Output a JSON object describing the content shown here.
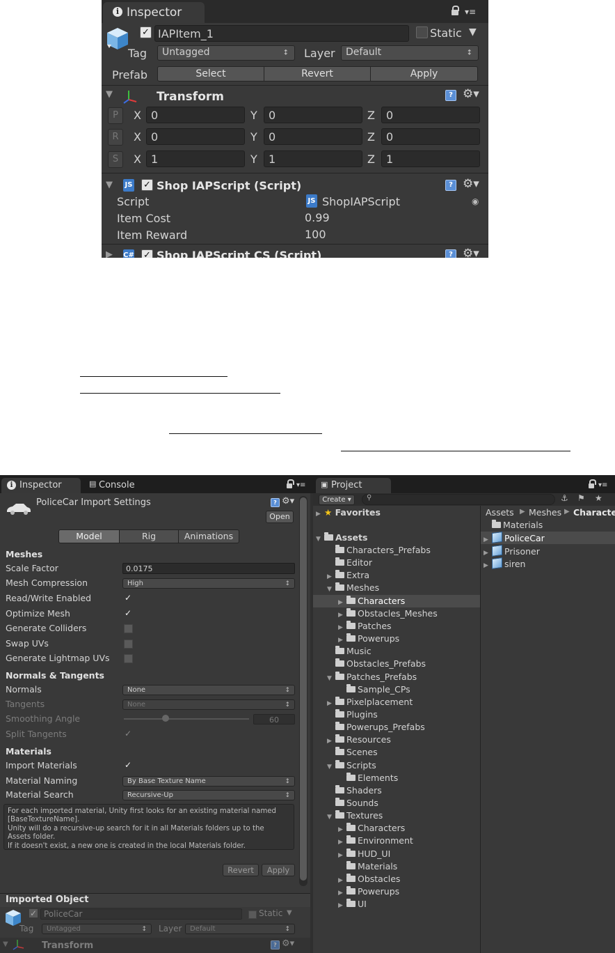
{
  "panel1": {
    "tab_label": "Inspector",
    "object_name": "IAPItem_1",
    "static_label": "Static",
    "tag_label": "Tag",
    "tag_value": "Untagged",
    "layer_label": "Layer",
    "layer_value": "Default",
    "prefab_label": "Prefab",
    "prefab_buttons": [
      "Select",
      "Revert",
      "Apply"
    ],
    "transform": {
      "title": "Transform",
      "rows": [
        {
          "btn": "P",
          "x": "0",
          "y": "0",
          "z": "0"
        },
        {
          "btn": "R",
          "x": "0",
          "y": "0",
          "z": "0"
        },
        {
          "btn": "S",
          "x": "1",
          "y": "1",
          "z": "1"
        }
      ],
      "axis_labels": [
        "X",
        "Y",
        "Z"
      ]
    },
    "script_component": {
      "title": "Shop IAPScript (Script)",
      "icon_text": "JS",
      "script_label": "Script",
      "script_value": "ShopIAPScript",
      "item_cost_label": "Item Cost",
      "item_cost_value": "0.99",
      "item_reward_label": "Item Reward",
      "item_reward_value": "100"
    },
    "next_component_title": "Shop IAPScript CS (Script)"
  },
  "panel2": {
    "tabs": {
      "inspector": "Inspector",
      "console": "Console",
      "project": "Project"
    },
    "import_title": "PoliceCar Import Settings",
    "open_button": "Open",
    "subtabs": [
      "Model",
      "Rig",
      "Animations"
    ],
    "meshes_header": "Meshes",
    "scale_factor_label": "Scale Factor",
    "scale_factor_value": "0.0175",
    "mesh_compression_label": "Mesh Compression",
    "mesh_compression_value": "High",
    "read_write_label": "Read/Write Enabled",
    "optimize_mesh_label": "Optimize Mesh",
    "generate_colliders_label": "Generate Colliders",
    "swap_uvs_label": "Swap UVs",
    "generate_lightmap_label": "Generate Lightmap UVs",
    "normals_header": "Normals & Tangents",
    "normals_label": "Normals",
    "normals_value": "None",
    "tangents_label": "Tangents",
    "tangents_value": "None",
    "smoothing_label": "Smoothing Angle",
    "smoothing_value": "60",
    "split_tangents_label": "Split Tangents",
    "materials_header": "Materials",
    "import_materials_label": "Import Materials",
    "material_naming_label": "Material Naming",
    "material_naming_value": "By Base Texture Name",
    "material_search_label": "Material Search",
    "material_search_value": "Recursive-Up",
    "help_lines": [
      "For each imported material, Unity first looks for an existing material named",
      "[BaseTextureName].",
      "Unity will do a recursive-up search for it in all Materials folders up to the",
      "Assets folder.",
      "If it doesn't exist, a new one is created in the local Materials folder."
    ],
    "revert_button": "Revert",
    "apply_button": "Apply",
    "imported_object_header": "Imported Object",
    "imported_name": "PoliceCar",
    "imported_static": "Static",
    "imported_tag_label": "Tag",
    "imported_tag_value": "Untagged",
    "imported_layer_label": "Layer",
    "imported_layer_value": "Default",
    "imported_transform": "Transform",
    "project": {
      "create_label": "Create",
      "favorites": "Favorites",
      "assets": "Assets",
      "tree": [
        {
          "label": "Characters_Prefabs",
          "indent": 1,
          "arrow": ""
        },
        {
          "label": "Editor",
          "indent": 1,
          "arrow": ""
        },
        {
          "label": "Extra",
          "indent": 1,
          "arrow": "right"
        },
        {
          "label": "Meshes",
          "indent": 1,
          "arrow": "down"
        },
        {
          "label": "Characters",
          "indent": 2,
          "arrow": "right",
          "selected": true
        },
        {
          "label": "Obstacles_Meshes",
          "indent": 2,
          "arrow": "right"
        },
        {
          "label": "Patches",
          "indent": 2,
          "arrow": "right"
        },
        {
          "label": "Powerups",
          "indent": 2,
          "arrow": "right"
        },
        {
          "label": "Music",
          "indent": 1,
          "arrow": ""
        },
        {
          "label": "Obstacles_Prefabs",
          "indent": 1,
          "arrow": ""
        },
        {
          "label": "Patches_Prefabs",
          "indent": 1,
          "arrow": "down"
        },
        {
          "label": "Sample_CPs",
          "indent": 2,
          "arrow": ""
        },
        {
          "label": "Pixelplacement",
          "indent": 1,
          "arrow": "right"
        },
        {
          "label": "Plugins",
          "indent": 1,
          "arrow": ""
        },
        {
          "label": "Powerups_Prefabs",
          "indent": 1,
          "arrow": ""
        },
        {
          "label": "Resources",
          "indent": 1,
          "arrow": "right"
        },
        {
          "label": "Scenes",
          "indent": 1,
          "arrow": ""
        },
        {
          "label": "Scripts",
          "indent": 1,
          "arrow": "down"
        },
        {
          "label": "Elements",
          "indent": 2,
          "arrow": ""
        },
        {
          "label": "Shaders",
          "indent": 1,
          "arrow": ""
        },
        {
          "label": "Sounds",
          "indent": 1,
          "arrow": ""
        },
        {
          "label": "Textures",
          "indent": 1,
          "arrow": "down"
        },
        {
          "label": "Characters",
          "indent": 2,
          "arrow": "right"
        },
        {
          "label": "Environment",
          "indent": 2,
          "arrow": "right"
        },
        {
          "label": "HUD_UI",
          "indent": 2,
          "arrow": "right"
        },
        {
          "label": "Materials",
          "indent": 2,
          "arrow": ""
        },
        {
          "label": "Obstacles",
          "indent": 2,
          "arrow": "right"
        },
        {
          "label": "Powerups",
          "indent": 2,
          "arrow": "right"
        },
        {
          "label": "UI",
          "indent": 2,
          "arrow": "right"
        }
      ],
      "breadcrumb": [
        "Assets",
        "Meshes",
        "Characters"
      ],
      "contents": [
        {
          "label": "Materials",
          "type": "folder"
        },
        {
          "label": "PoliceCar",
          "type": "mesh",
          "selected": true
        },
        {
          "label": "Prisoner",
          "type": "mesh"
        },
        {
          "label": "siren",
          "type": "mesh"
        }
      ]
    }
  }
}
